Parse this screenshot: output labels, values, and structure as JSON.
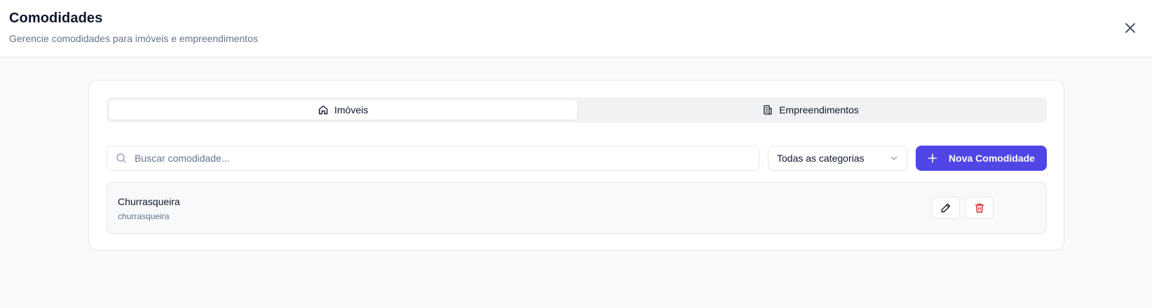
{
  "header": {
    "title": "Comodidades",
    "subtitle": "Gerencie comodidades para imóveis e empreendimentos",
    "close_icon": "close-icon"
  },
  "tabs": [
    {
      "label": "Imóveis",
      "icon": "home-icon",
      "active": true
    },
    {
      "label": "Empreendimentos",
      "icon": "building-icon",
      "active": false
    }
  ],
  "search": {
    "placeholder": "Buscar comodidade...",
    "value": "",
    "icon": "search-icon"
  },
  "category_filter": {
    "selected": "Todas as categorias",
    "icon": "chevron-down-icon"
  },
  "new_button": {
    "label": "Nova Comodidade",
    "icon": "plus-icon"
  },
  "items": [
    {
      "name": "Churrasqueira",
      "slug": "churrasqueira",
      "edit_icon": "pencil-icon",
      "delete_icon": "trash-icon"
    }
  ],
  "colors": {
    "accent": "#4f46e5",
    "danger": "#dc2626",
    "background": "#f8f9fb"
  }
}
